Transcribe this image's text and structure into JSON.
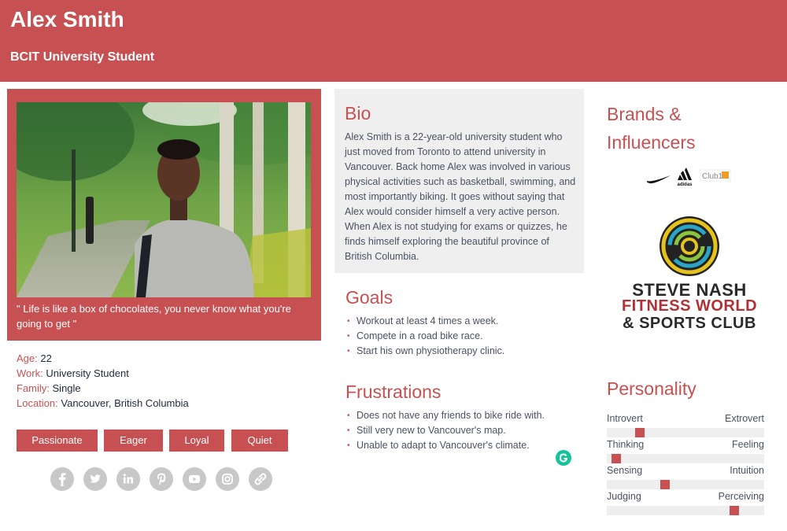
{
  "header": {
    "name": "Alex Smith",
    "subtitle": "BCIT University Student"
  },
  "profile": {
    "quote": "\" Life is like a box of chocolates, you never know what you're going to get \"",
    "facts": [
      {
        "key": "Age:",
        "value": "22"
      },
      {
        "key": "Work:",
        "value": "University Student"
      },
      {
        "key": "Family:",
        "value": "Single"
      },
      {
        "key": "Location:",
        "value": "Vancouver, British Columbia"
      }
    ],
    "tags": [
      "Passionate",
      "Eager",
      "Loyal",
      "Quiet"
    ],
    "socials": [
      "facebook-icon",
      "twitter-icon",
      "linkedin-icon",
      "pinterest-icon",
      "youtube-icon",
      "instagram-icon",
      "link-icon"
    ]
  },
  "bio": {
    "title": "Bio",
    "text": "Alex Smith is a 22-year-old university student who just moved from Toronto to attend university in Vancouver. Back home Alex was involved in various physical activities such as basketball, swimming, and most importantly biking. It goes without saying that Alex would consider himself a very active person. When Alex is not studying for exams or quizzes, he finds himself exploring the beautiful province of British Columbia."
  },
  "goals": {
    "title": "Goals",
    "items": [
      "Workout at least 4 times a week.",
      "Compete in a road bike race.",
      "Start his own physiotherapy clinic."
    ]
  },
  "frustrations": {
    "title": "Frustrations",
    "items": [
      "Does not have any friends to bike ride with.",
      "Still very new to Vancouver's map.",
      "Unable to adapt to Vancouver's climate."
    ]
  },
  "brands": {
    "title": "Brands & Influencers",
    "small_logo_text": "Club16",
    "logo_lines": [
      "STEVE NASH",
      "FITNESS WORLD",
      "& SPORTS CLUB"
    ]
  },
  "personality": {
    "title": "Personality",
    "traits": [
      {
        "left": "Introvert",
        "right": "Extrovert",
        "level": 0.21
      },
      {
        "left": "Thinking",
        "right": "Feeling",
        "level": 0.06
      },
      {
        "left": "Sensing",
        "right": "Intuition",
        "level": 0.37
      },
      {
        "left": "Judging",
        "right": "Perceiving",
        "level": 0.81
      }
    ]
  },
  "colors": {
    "accent": "#c75152",
    "panel": "#efefef",
    "text": "#4a5262",
    "grammarly": "#15c39a"
  }
}
